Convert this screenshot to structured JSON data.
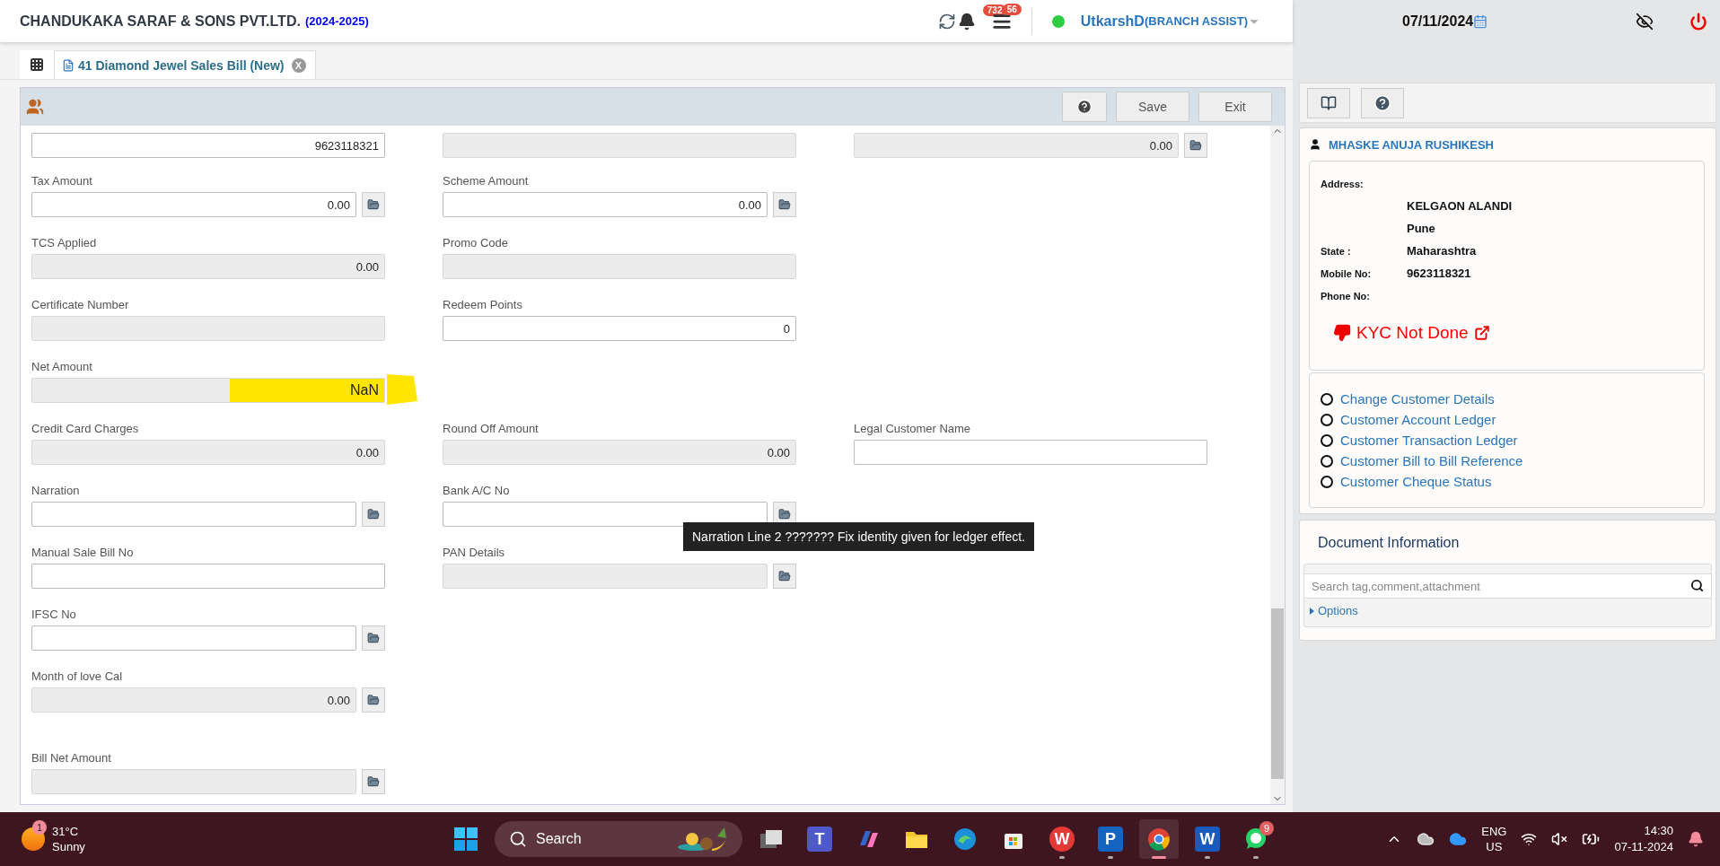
{
  "header": {
    "company": "CHANDUKAKA SARAF & SONS PVT.LTD.",
    "year": "(2024-2025)",
    "notifications": "732",
    "tasks": "56",
    "online": true,
    "user": "UtkarshD",
    "role": "(BRANCH ASSIST)",
    "date": "07/11/2024"
  },
  "tabs": [
    {
      "label": "41 Diamond Jewel Sales Bill (New)",
      "selected": true,
      "close": "X"
    }
  ],
  "toolbar": {
    "buttons": [
      "Save",
      "Exit"
    ]
  },
  "form": {
    "rows": [
      [
        {
          "value": "9623118321",
          "disabled": false,
          "picker": false
        },
        {
          "disabled": true,
          "picker": false
        },
        {
          "value": "0.00",
          "disabled": true,
          "picker": true
        }
      ],
      [
        {
          "label": "Tax Amount",
          "value": "0.00",
          "disabled": false,
          "picker": true
        },
        {
          "label": "Scheme Amount",
          "value": "0.00",
          "disabled": false,
          "picker": true
        },
        null
      ],
      [
        {
          "label": "TCS Applied",
          "value": "0.00",
          "disabled": true,
          "picker": false
        },
        {
          "label": "Promo Code",
          "disabled": true,
          "picker": false
        },
        null
      ],
      [
        {
          "label": "Certificate Number",
          "disabled": true,
          "picker": false
        },
        {
          "label": "Redeem Points",
          "value": "0",
          "disabled": false,
          "picker": false
        },
        null
      ],
      [
        {
          "label": "Net Amount",
          "value": "NaN",
          "disabled": true,
          "picker": false,
          "highlight": true
        },
        null,
        null
      ],
      [
        {
          "label": "Credit Card Charges",
          "value": "0.00",
          "disabled": true,
          "picker": false
        },
        {
          "label": "Round Off Amount",
          "value": "0.00",
          "disabled": true,
          "picker": false
        },
        {
          "label": "Legal Customer Name",
          "disabled": false,
          "picker": false
        }
      ],
      [
        {
          "label": "Narration",
          "disabled": false,
          "picker": true
        },
        {
          "label": "Bank A/C No",
          "disabled": false,
          "picker": true
        },
        null
      ],
      [
        {
          "label": "Manual Sale Bill No",
          "disabled": false,
          "picker": false
        },
        {
          "label": "PAN Details",
          "disabled": true,
          "picker": true
        },
        null
      ],
      [
        {
          "label": "IFSC No",
          "disabled": false,
          "picker": true
        },
        null,
        null
      ],
      [
        {
          "label": "Month of love Cal",
          "value": "0.00",
          "disabled": true,
          "picker": true
        },
        null,
        null
      ],
      [
        {
          "label": "Bill Net Amount",
          "disabled": true,
          "picker": true
        },
        null,
        null
      ]
    ]
  },
  "tooltip": "Narration Line 2 ??????? Fix identity given for ledger effect.",
  "customer": {
    "name": "MHASKE ANUJA RUSHIKESH",
    "details": [
      {
        "label": "Address:"
      },
      {
        "value": "KELGAON ALANDI"
      },
      {
        "value": "Pune"
      },
      {
        "label": "State :",
        "value": "Maharashtra"
      },
      {
        "label": "Mobile No:",
        "value": "9623118321"
      },
      {
        "label": "Phone No:"
      }
    ],
    "kyc": "KYC Not Done",
    "links": [
      {
        "label": "Change Customer Details",
        "selected": false
      },
      {
        "label": "Customer Account Ledger",
        "selected": false
      },
      {
        "label": "Customer Transaction Ledger",
        "selected": false
      },
      {
        "label": "Customer Bill to Bill Reference",
        "selected": false
      },
      {
        "label": "Customer Cheque Status",
        "selected": false
      }
    ]
  },
  "documents": {
    "title": "Document Information",
    "placeholder": "Search tag,comment,attachment",
    "options": "Options"
  },
  "taskbar": {
    "weather": {
      "badge": "1",
      "temperature": "31°C",
      "condition": "Sunny"
    },
    "search": "Search",
    "apps": [
      {
        "kind": "taskview",
        "running": false,
        "selected": false
      },
      {
        "kind": "teams",
        "glyph": "T",
        "running": false,
        "selected": false
      },
      {
        "kind": "copilot",
        "running": false,
        "selected": false
      },
      {
        "kind": "files",
        "running": false,
        "selected": false
      },
      {
        "kind": "edge",
        "running": false,
        "selected": false
      },
      {
        "kind": "store",
        "running": false,
        "selected": false
      },
      {
        "kind": "wps",
        "glyph": "W",
        "running": true,
        "selected": false
      },
      {
        "kind": "pdf",
        "glyph": "P",
        "running": true,
        "selected": false
      },
      {
        "kind": "chrome",
        "running": true,
        "selected": true
      },
      {
        "kind": "word",
        "glyph": "W",
        "running": true,
        "selected": false
      },
      {
        "kind": "whatsapp",
        "badge": "9",
        "running": true,
        "selected": false
      }
    ],
    "language": "ENG",
    "region": "US",
    "time": "14:30",
    "date": "07-11-2024"
  }
}
